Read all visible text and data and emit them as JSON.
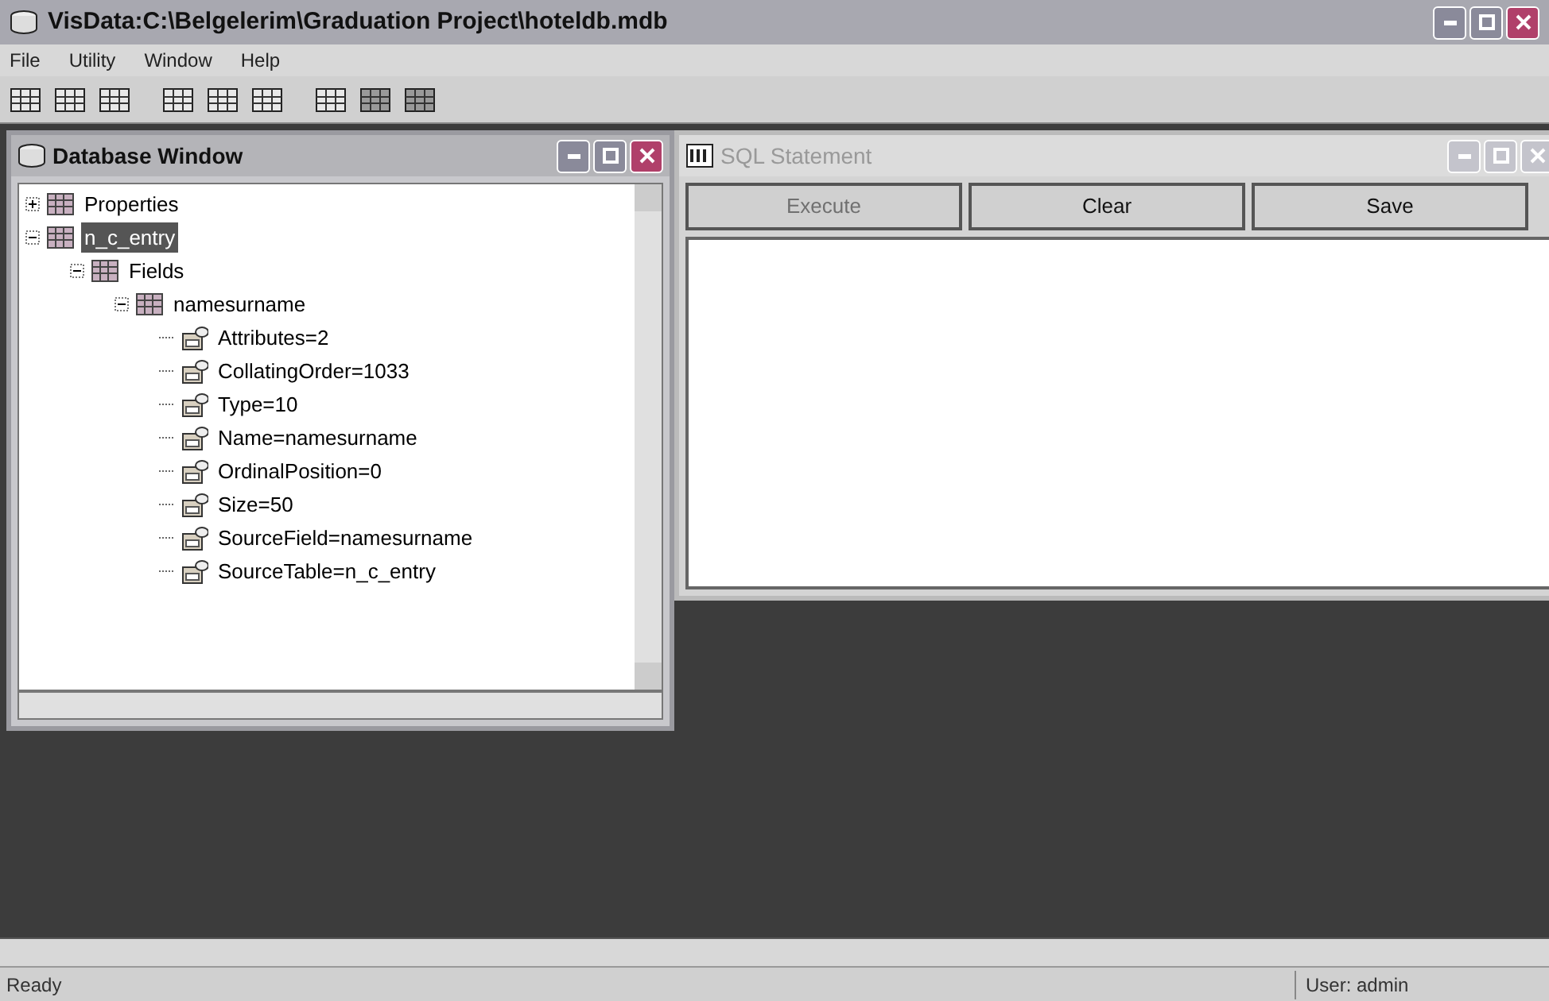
{
  "window": {
    "title": "VisData:C:\\Belgelerim\\Graduation Project\\hoteldb.mdb"
  },
  "menu": [
    "File",
    "Utility",
    "Window",
    "Help"
  ],
  "database_window": {
    "title": "Database Window",
    "active": true,
    "tree": [
      {
        "label": "Properties",
        "expanded": false,
        "selected": false
      },
      {
        "label": "n_c_entry",
        "expanded": true,
        "selected": true,
        "children": [
          {
            "label": "Fields",
            "expanded": true,
            "selected": false,
            "children": [
              {
                "label": "namesurname",
                "expanded": true,
                "selected": false,
                "children": [
                  {
                    "label": "Attributes=2",
                    "selected": false
                  },
                  {
                    "label": "CollatingOrder=1033",
                    "selected": false
                  },
                  {
                    "label": "Type=10",
                    "selected": false
                  },
                  {
                    "label": "Name=namesurname",
                    "selected": false
                  },
                  {
                    "label": "OrdinalPosition=0",
                    "selected": false
                  },
                  {
                    "label": "Size=50",
                    "selected": false
                  },
                  {
                    "label": "SourceField=namesurname",
                    "selected": false
                  },
                  {
                    "label": "SourceTable=n_c_entry",
                    "selected": false
                  }
                ]
              }
            ]
          }
        ]
      }
    ]
  },
  "sql_window": {
    "title": "SQL Statement",
    "active": false,
    "buttons": [
      {
        "label": "Execute",
        "disabled": true
      },
      {
        "label": "Clear",
        "disabled": false
      },
      {
        "label": "Save",
        "disabled": false
      }
    ]
  },
  "status_bar": {
    "message": "Ready",
    "user": "User: admin"
  }
}
